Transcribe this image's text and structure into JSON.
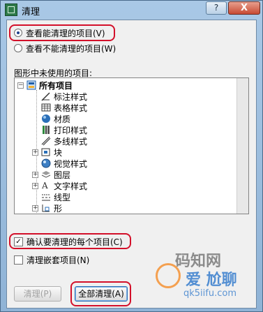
{
  "window": {
    "title": "清理",
    "help": "?",
    "close": "X"
  },
  "radios": [
    {
      "label": "查看能清理的项目(V)",
      "selected": true
    },
    {
      "label": "查看不能清理的项目(W)",
      "selected": false
    }
  ],
  "tree": {
    "label": "图形中未使用的项目:",
    "root": "所有项目",
    "items": [
      {
        "label": "标注样式",
        "icon": "dimension-style-icon",
        "expandable": false
      },
      {
        "label": "表格样式",
        "icon": "table-style-icon",
        "expandable": false
      },
      {
        "label": "材质",
        "icon": "material-sphere-icon",
        "expandable": false
      },
      {
        "label": "打印样式",
        "icon": "plot-style-icon",
        "expandable": false
      },
      {
        "label": "多线样式",
        "icon": "multiline-style-icon",
        "expandable": false
      },
      {
        "label": "块",
        "icon": "block-icon",
        "expandable": true
      },
      {
        "label": "视觉样式",
        "icon": "visual-style-icon",
        "expandable": false
      },
      {
        "label": "图层",
        "icon": "layer-icon",
        "expandable": true
      },
      {
        "label": "文字样式",
        "icon": "text-style-icon",
        "expandable": true
      },
      {
        "label": "线型",
        "icon": "linetype-icon",
        "expandable": false
      },
      {
        "label": "形",
        "icon": "shape-icon",
        "expandable": true
      }
    ]
  },
  "checkboxes": [
    {
      "label": "确认要清理的每个项目(C)",
      "checked": true
    },
    {
      "label": "清理嵌套项目(N)",
      "checked": false
    }
  ],
  "buttons": {
    "purge": "清理(P)",
    "purge_all": "全部清理(A)"
  },
  "watermark": {
    "line1": "码知网",
    "line2": "爱 尬聊",
    "line3": "qk5iifu.com"
  },
  "colors": {
    "highlight": "#d3102a",
    "titlebar": "#a9c8e6"
  }
}
